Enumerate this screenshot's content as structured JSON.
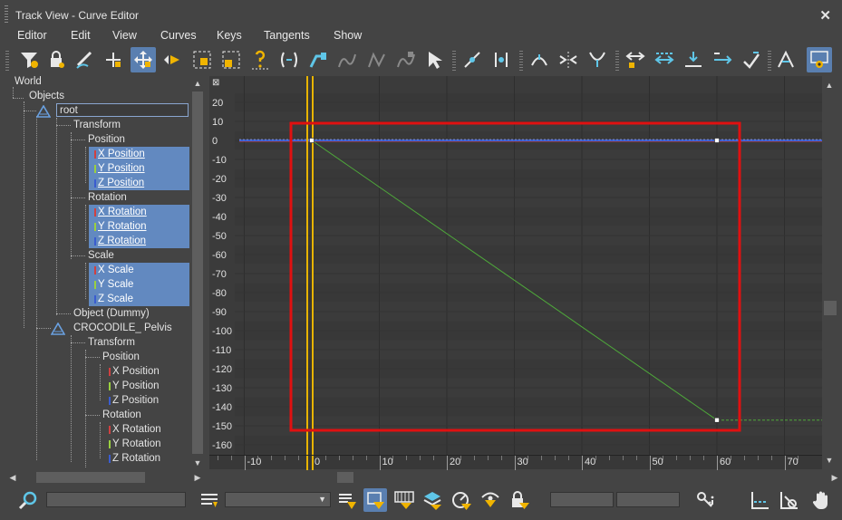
{
  "window": {
    "title": "Track View - Curve Editor",
    "close_glyph": "✕"
  },
  "menu": [
    "Editor",
    "Edit",
    "View",
    "Curves",
    "Keys",
    "Tangents",
    "Show"
  ],
  "toolbar_icons": [
    "filter-icon",
    "lock-selection-icon",
    "draw-curves-icon",
    "add-key-icon",
    "move-keys-icon",
    "slide-keys-icon",
    "scale-keys-icon",
    "scale-values-icon",
    "add-visibility-track-icon",
    "parameter-curve-out-of-range-icon",
    "region-tool-icon",
    "retimer-icon",
    "global-retimer-icon",
    "snap-frames-icon",
    "show-keyable-icons-icon",
    "select-icon",
    "break-tangents-icon",
    "unify-tangents-icon",
    "lock-tangents-icon",
    "zoom-horizontal-icon",
    "zoom-value-icon",
    "auto-tangent-icon",
    "spline-tangent-icon",
    "fast-tangent-icon",
    "slow-tangent-icon",
    "step-tangent-icon",
    "linear-tangent-icon",
    "show-tangents-icon",
    "isolate-curve-icon"
  ],
  "tree": {
    "world": "World",
    "objects": "Objects",
    "root": "root",
    "transform": "Transform",
    "position": "Position",
    "x_position": "X Position",
    "y_position": "Y Position",
    "z_position": "Z Position",
    "rotation": "Rotation",
    "x_rotation": "X Rotation",
    "y_rotation": "Y Rotation",
    "z_rotation": "Z Rotation",
    "scale": "Scale",
    "x_scale": "X Scale",
    "y_scale": "Y Scale",
    "z_scale": "Z Scale",
    "object_dummy": "Object (Dummy)",
    "pelvis": "CROCODILE_ Pelvis",
    "transform2": "Transform",
    "position2": "Position",
    "x_position2": "X Position",
    "y_position2": "Y Position",
    "z_position2": "Z Position",
    "rotation2": "Rotation",
    "x_rotation2": "X Rotation",
    "y_rotation2": "Y Rotation",
    "z_rotation2": "Z Rotation"
  },
  "graph": {
    "y_ticks": [
      "20",
      "10",
      "0",
      "-10",
      "-20",
      "-30",
      "-40",
      "-50",
      "-60",
      "-70",
      "-80",
      "-90",
      "-100",
      "-110",
      "-120",
      "-130",
      "-140",
      "-150",
      "-160"
    ],
    "x_ticks": [
      "-10",
      "0",
      "10",
      "20",
      "30",
      "40",
      "50",
      "60",
      "70"
    ],
    "current_frame": 0,
    "colors": {
      "x_curve": "#d04040",
      "y_curve": "#4ea83a",
      "z_curve": "#3a5cd0",
      "time_slider": "#e8b400",
      "selection_box": "#e01010",
      "background": "#3b3b3b"
    },
    "curves": [
      {
        "name": "X Position",
        "keys": [
          [
            0,
            0
          ],
          [
            60,
            0
          ]
        ]
      },
      {
        "name": "Y Position",
        "keys": [
          [
            0,
            0
          ],
          [
            60,
            -147
          ]
        ]
      },
      {
        "name": "Z Position",
        "keys": [
          [
            0,
            0
          ],
          [
            60,
            0
          ]
        ]
      }
    ]
  },
  "statusbar": {
    "icons": [
      "zoom-selected-object-icon",
      "show-selected-keys-stats-icon",
      "filter-selected-tracks-icon",
      "filter-selected-objects-icon",
      "filter-animated-tracks-icon",
      "filter-unlocked-attributes-icon",
      "filter-animated-objects-icon",
      "filter-controller-types-icon",
      "filter-visible-objects-icon",
      "filter-locked-tracks-icon",
      "key-info-icon",
      "pan-icon-graph",
      "zoom-region-icon",
      "hand-pan-icon"
    ]
  }
}
